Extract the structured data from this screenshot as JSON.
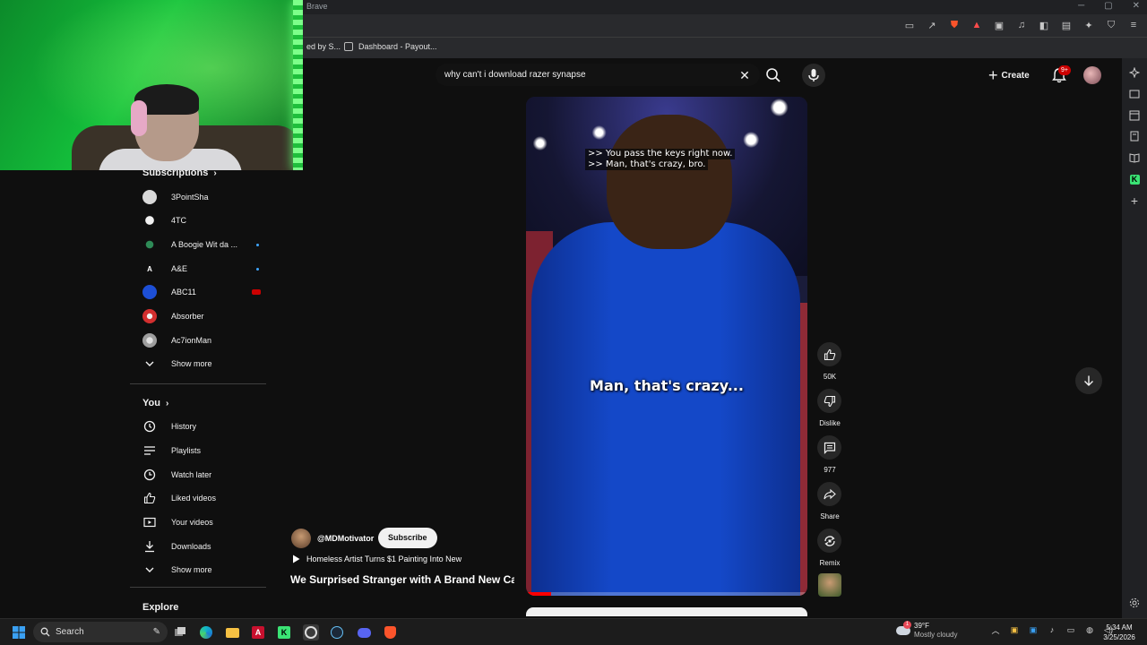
{
  "browser": {
    "title": "Brave",
    "bookmarks": [
      {
        "label": "ed by S..."
      },
      {
        "label": "Dashboard - Payout..."
      }
    ]
  },
  "masthead": {
    "search_value": "why can't i download razer synapse",
    "create_label": "Create",
    "notification_count": "9+"
  },
  "guide": {
    "subscriptions_header": "Subscriptions",
    "subscriptions": [
      {
        "label": "3PointSha",
        "color": "#d9d9d9"
      },
      {
        "label": "4TC",
        "color": "#f1f1f1"
      },
      {
        "label": "A Boogie Wit da ...",
        "color": "#2e8b57"
      },
      {
        "label": "A&E",
        "color": "#0f0f0f"
      },
      {
        "label": "ABC11",
        "color": "#1d4fd6"
      },
      {
        "label": "Absorber",
        "color": "#d32f2f"
      },
      {
        "label": "Ac7ionMan",
        "color": "#9e9e9e"
      }
    ],
    "subs_show_more": "Show more",
    "you_header": "You",
    "you_items": [
      {
        "label": "History",
        "icon": "history-icon"
      },
      {
        "label": "Playlists",
        "icon": "playlists-icon"
      },
      {
        "label": "Watch later",
        "icon": "watch-later-icon"
      },
      {
        "label": "Liked videos",
        "icon": "like-icon"
      },
      {
        "label": "Your videos",
        "icon": "your-videos-icon"
      },
      {
        "label": "Downloads",
        "icon": "download-icon"
      }
    ],
    "you_show_more": "Show more",
    "explore_header": "Explore"
  },
  "short": {
    "captions": [
      ">> You pass the keys right now.",
      ">> Man, that's crazy, bro."
    ],
    "burned_caption": "Man, that's crazy...",
    "progress": 0.09,
    "channel": "@MDMotivator",
    "subscribe_label": "Subscribe",
    "related": "Homeless Artist Turns $1 Painting Into New",
    "title": "We Surprised Stranger with A Brand New Car"
  },
  "actions": {
    "like_count": "50K",
    "dislike_label": "Dislike",
    "comment_count": "977",
    "share_label": "Share",
    "remix_label": "Remix"
  },
  "taskbar": {
    "search_label": "Search",
    "weather_badge": "1",
    "temperature": "39°F",
    "weather_desc": "Mostly cloudy",
    "time": "5:34 AM",
    "date": "3/25/2026"
  }
}
